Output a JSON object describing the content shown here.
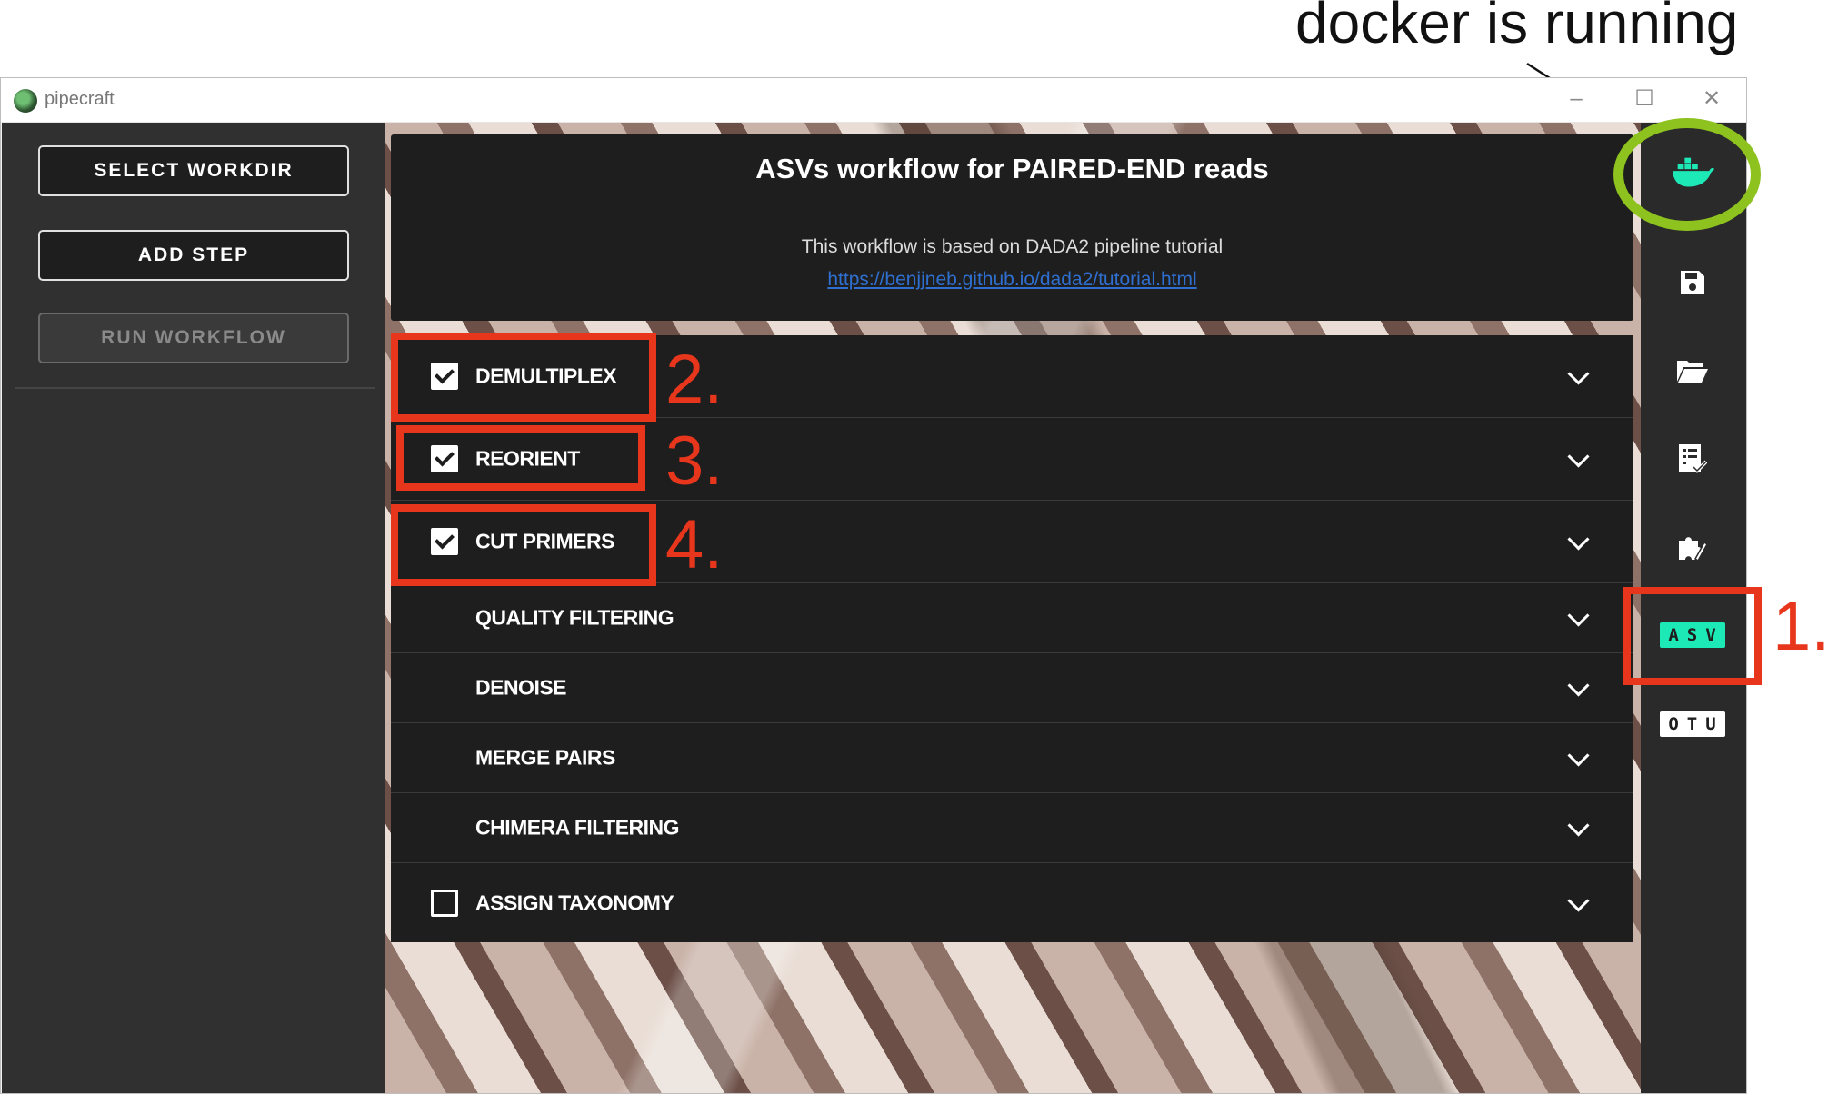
{
  "annotations": {
    "docker_note": "docker is running",
    "marker_1": "1.",
    "marker_2": "2.",
    "marker_3": "3.",
    "marker_4": "4."
  },
  "window": {
    "title": "pipecraft",
    "controls": [
      "minimize",
      "maximize",
      "close"
    ]
  },
  "sidebar": {
    "select_workdir": "SELECT WORKDIR",
    "add_step": "ADD STEP",
    "run_workflow": "RUN WORKFLOW",
    "run_workflow_disabled": true
  },
  "header": {
    "title": "ASVs workflow for PAIRED-END reads",
    "description": "This workflow is based on DADA2 pipeline tutorial",
    "link": "https://benjjneb.github.io/dada2/tutorial.html"
  },
  "steps": [
    {
      "label": "DEMULTIPLEX",
      "checkbox": true,
      "checked": true
    },
    {
      "label": "REORIENT",
      "checkbox": true,
      "checked": true
    },
    {
      "label": "CUT PRIMERS",
      "checkbox": true,
      "checked": true
    },
    {
      "label": "QUALITY FILTERING",
      "checkbox": false
    },
    {
      "label": "DENOISE",
      "checkbox": false
    },
    {
      "label": "MERGE PAIRS",
      "checkbox": false
    },
    {
      "label": "CHIMERA FILTERING",
      "checkbox": false
    },
    {
      "label": "ASSIGN TAXONOMY",
      "checkbox": true,
      "checked": false
    }
  ],
  "right_bar": {
    "icons": [
      "docker-icon",
      "save-icon",
      "folder-open-icon",
      "checklist-icon",
      "puzzle-icon"
    ],
    "asv_label": "ASV",
    "otu_label": "OTU",
    "colors": {
      "docker": "#1de9b6",
      "asv_badge": "#1de9b6",
      "otu_badge": "#ffffff"
    }
  },
  "colors": {
    "annotation_red": "#e8361d",
    "annotation_green": "#8dc21f",
    "panel_dark": "#1e1e1e",
    "sidebar": "#303030"
  }
}
